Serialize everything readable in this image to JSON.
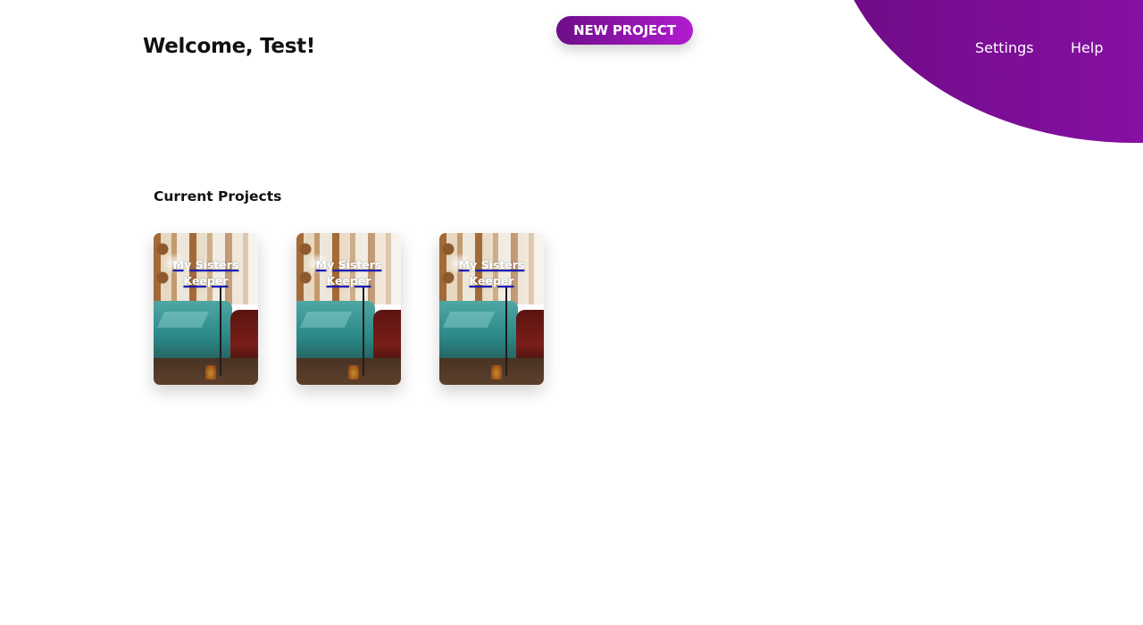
{
  "header": {
    "welcome": "Welcome, Test!",
    "new_project_label": "NEW PROJECT",
    "nav": {
      "settings": "Settings",
      "help": "Help"
    }
  },
  "projects": {
    "section_title": "Current Projects",
    "items": [
      {
        "title": "My Sisters Keeper"
      },
      {
        "title": "My Sisters Keeper"
      },
      {
        "title": "My Sisters Keeper"
      }
    ]
  },
  "colors": {
    "accent_start": "#6d0d87",
    "accent_end": "#b11ccf",
    "link_underline": "#1b1bbf"
  }
}
